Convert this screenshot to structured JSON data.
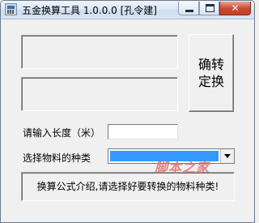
{
  "window": {
    "title": "五金换算工具 1.0.0.0 [孔令建]",
    "close_glyph": "✕",
    "icons": {
      "app": "app-icon",
      "minimize": "minimize-icon",
      "maximize": "maximize-icon",
      "close": "close-icon"
    }
  },
  "main": {
    "display_1_value": "",
    "display_2_value": "",
    "confirm_button": {
      "line1": "确转",
      "line2": "定换"
    },
    "length_label": "请输入长度（米）",
    "length_value": "",
    "material_label": "选择物料的种类",
    "material_selected": "",
    "formula_text": "换算公式介绍,请选择好要转换的物料种类!",
    "selection_color": "#3399ff"
  },
  "watermark": {
    "text": "脚本之家"
  }
}
